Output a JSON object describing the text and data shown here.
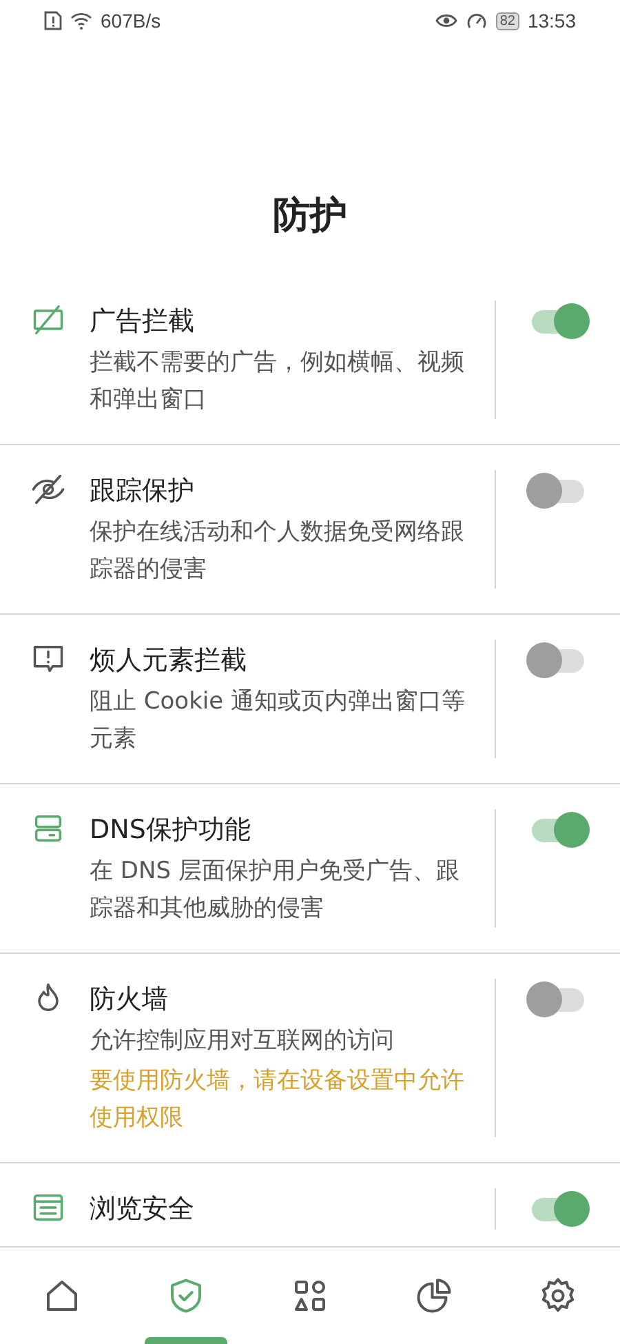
{
  "status_bar": {
    "speed": "607B/s",
    "battery": "82",
    "time": "13:53"
  },
  "title": "防护",
  "features": [
    {
      "kind": "ad-block",
      "title": "广告拦截",
      "description": "拦截不需要的广告，例如横幅、视频和弹出窗口",
      "on": true
    },
    {
      "kind": "tracking",
      "title": "跟踪保护",
      "description": "保护在线活动和个人数据免受网络跟踪器的侵害",
      "on": false
    },
    {
      "kind": "annoyance",
      "title": "烦人元素拦截",
      "description": "阻止 Cookie 通知或页内弹出窗口等元素",
      "on": false
    },
    {
      "kind": "dns",
      "title": "DNS保护功能",
      "description": "在 DNS 层面保护用户免受广告、跟踪器和其他威胁的侵害",
      "on": true
    },
    {
      "kind": "firewall",
      "title": "防火墙",
      "description": "允许控制应用对互联网的访问",
      "warning": "要使用防火墙，请在设备设置中允许使用权限",
      "on": false
    },
    {
      "kind": "browsing",
      "title": "浏览安全",
      "on": true
    }
  ],
  "nav": [
    {
      "kind": "home",
      "selected": false
    },
    {
      "kind": "shield",
      "selected": true
    },
    {
      "kind": "apps",
      "selected": false
    },
    {
      "kind": "stats",
      "selected": false
    },
    {
      "kind": "settings",
      "selected": false
    }
  ]
}
